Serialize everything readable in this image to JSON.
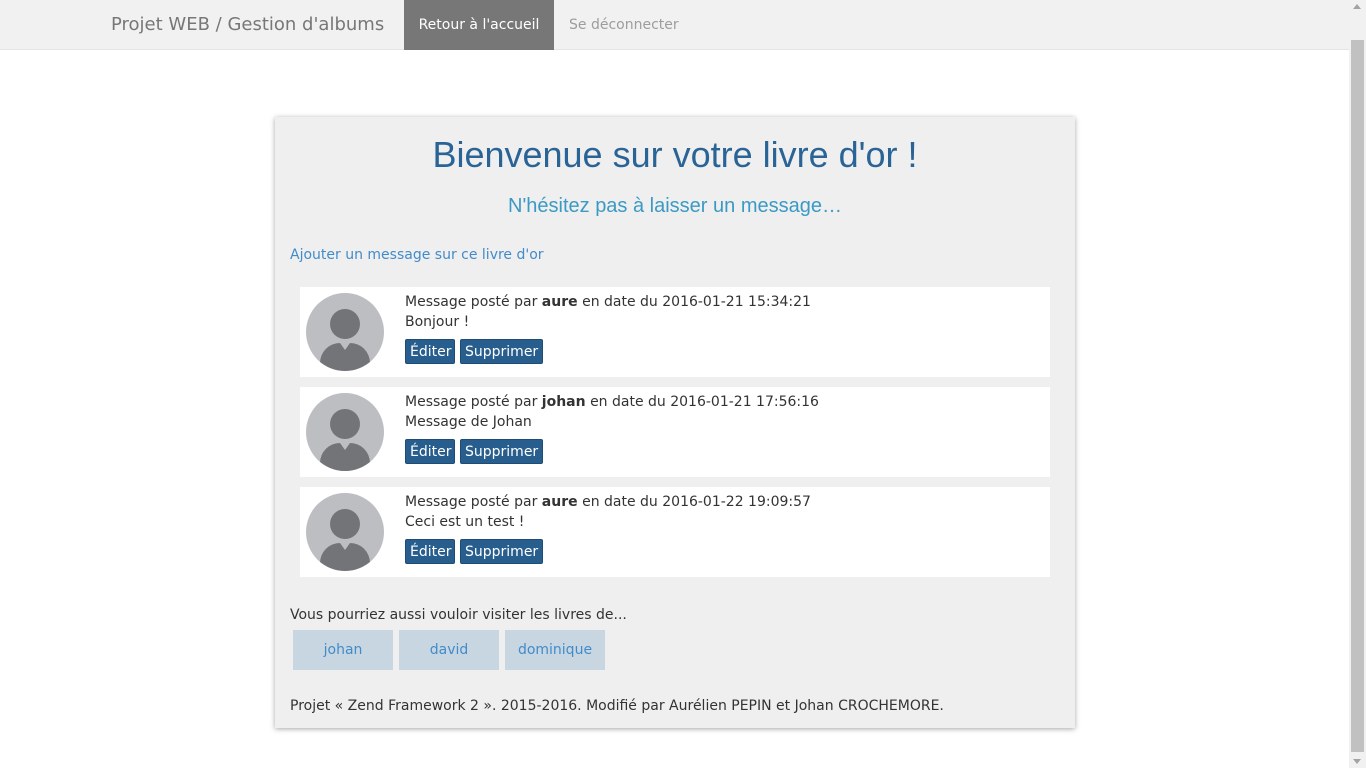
{
  "navbar": {
    "brand": "Projet WEB / Gestion d'albums",
    "home": "Retour à l'accueil",
    "logout": "Se déconnecter"
  },
  "main": {
    "title": "Bienvenue sur votre livre d'or !",
    "subtitle": "N'hésitez pas à laisser un message…",
    "add_link": "Ajouter un message sur ce livre d'or",
    "messages": [
      {
        "prefix": "Message posté par",
        "author": "aure",
        "date_prefix": "en date du",
        "date": "2016-01-21 15:34:21",
        "text": "Bonjour !",
        "edit": "Éditer",
        "delete": "Supprimer"
      },
      {
        "prefix": "Message posté par",
        "author": "johan",
        "date_prefix": "en date du",
        "date": "2016-01-21 17:56:16",
        "text": "Message de Johan",
        "edit": "Éditer",
        "delete": "Supprimer"
      },
      {
        "prefix": "Message posté par",
        "author": "aure",
        "date_prefix": "en date du",
        "date": "2016-01-22 19:09:57",
        "text": "Ceci est un test !",
        "edit": "Éditer",
        "delete": "Supprimer"
      }
    ],
    "suggest_label": "Vous pourriez aussi vouloir visiter les livres de...",
    "suggestions": [
      "johan",
      "david",
      "dominique"
    ],
    "footer": "Projet « Zend Framework 2 ». 2015-2016. Modifié par Aurélien PEPIN et Johan CROCHEMORE."
  },
  "colors": {
    "title": "#2a6496",
    "subtitle": "#3b9ac4",
    "button": "#285e8e",
    "link": "#428bca",
    "panel": "#efefef",
    "nav_active": "#777777"
  },
  "icons": [
    "user-avatar-icon"
  ]
}
